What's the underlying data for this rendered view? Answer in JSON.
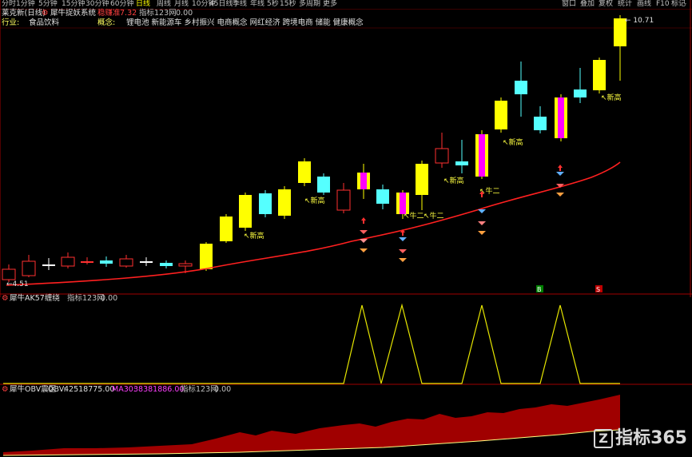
{
  "topbar": {
    "periods": [
      "分时",
      "1分钟",
      "5分钟",
      "15分钟",
      "30分钟",
      "60分钟",
      "日线",
      "周线",
      "月线",
      "10分钟",
      "45日线",
      "季线",
      "年线",
      "5秒",
      "15秒",
      "多周期",
      "更多"
    ],
    "active_index": 6,
    "right": [
      "窗口",
      "叠加",
      "复权",
      "统计",
      "画线",
      "F10",
      "标记",
      "-"
    ]
  },
  "title": {
    "stock": "莱克新(日线)",
    "system": "犀牛捉妖系统",
    "sig_label": "稳赚准",
    "sig_value": "7.32",
    "indicator": "指标123网",
    "zero": "0.00"
  },
  "info": {
    "industry_label": "行业:",
    "industry": "食品饮料",
    "concept_label": "概念:",
    "concept": "锂电池 新能源车 乡村振兴 电商概念 网红经济 跨境电商 储能 健康概念"
  },
  "main_chart": {
    "high_label": "10.71",
    "low_label": "4.51",
    "markers": [
      "新高",
      "新高",
      "新高",
      "新高",
      "牛二",
      "牛二",
      "牛二",
      "新高"
    ],
    "bottom_marks": [
      "B",
      "S"
    ],
    "colors": {
      "up": "#ff3030",
      "down_fill": "#55ffff",
      "yellow": "#ffff00",
      "magenta": "#ff00ff",
      "ma": "#ff2020"
    }
  },
  "panel2": {
    "title": "犀牛AK57缠绕",
    "indicator": "指标123网",
    "value": "0.00",
    "color": "#e6e600"
  },
  "panel3": {
    "title": "犀牛OBV震区",
    "obv_label": "OBV:",
    "obv_value": "42518775.00",
    "ma_label": "MA30:",
    "ma_value": "38381886.00",
    "indicator": "指标123网",
    "value": "0.00",
    "fill_color": "#a00000"
  },
  "watermark": "指标365"
}
